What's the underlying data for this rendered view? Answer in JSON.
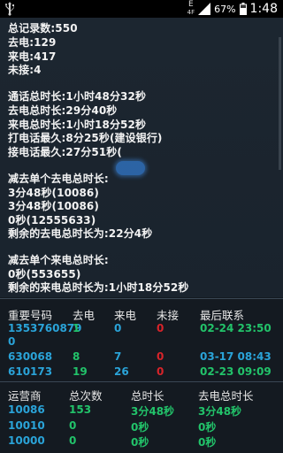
{
  "status_bar": {
    "signal_letters": "E",
    "signal_sub": "4F",
    "battery": "67%",
    "time": "1:48"
  },
  "summary": {
    "total_records": "总记录数:550",
    "outgoing": "去电:129",
    "incoming": "来电:417",
    "missed": "未接:4",
    "total_call_time": "通话总时长:1小时48分32秒",
    "out_total": "去电总时长:29分40秒",
    "in_total": "来电总时长:1小时18分52秒",
    "longest_out": "打电话最久:8分25秒(建设银行)",
    "longest_in": "接电话最久:27分51秒(",
    "minus_out_title": "减去单个去电总时长:",
    "minus_out_items": [
      "3分48秒(10086)",
      "3分48秒(10086)",
      "0秒(12555633)"
    ],
    "minus_out_remain": "剩余的去电总时长为:22分4秒",
    "minus_in_title": "减去单个来电总时长:",
    "minus_in_items": [
      "0秒(553655)"
    ],
    "minus_in_remain": "剩余的来电总时长为:1小时18分52秒"
  },
  "contacts_table": {
    "headers": [
      "重要号码",
      "去电",
      "来电",
      "未接",
      "最后联系"
    ],
    "rows": [
      {
        "number": "13537608790",
        "number_line1": "1353760879",
        "number_line2": "0",
        "out": "1",
        "in": "0",
        "missed": "0",
        "last": "02-24 23:50"
      },
      {
        "number": "630068",
        "out": "8",
        "in": "7",
        "missed": "0",
        "last": "03-17 08:43"
      },
      {
        "number": "610173",
        "out": "19",
        "in": "26",
        "missed": "0",
        "last": "02-23 09:09"
      }
    ]
  },
  "carrier_table": {
    "headers": [
      "运营商",
      "总次数",
      "总时长",
      "去电总时长"
    ],
    "rows": [
      {
        "carrier": "10086",
        "count": "153",
        "total": "3分48秒",
        "out_total": "3分48秒"
      },
      {
        "carrier": "10010",
        "count": "0",
        "total": "0秒",
        "out_total": "0秒"
      },
      {
        "carrier": "10000",
        "count": "0",
        "total": "0秒",
        "out_total": "0秒"
      }
    ]
  },
  "colors": {
    "background": "#141a21",
    "number_blue": "#2aa3d8",
    "value_green": "#22c36a",
    "missed_red": "#d8242a"
  }
}
